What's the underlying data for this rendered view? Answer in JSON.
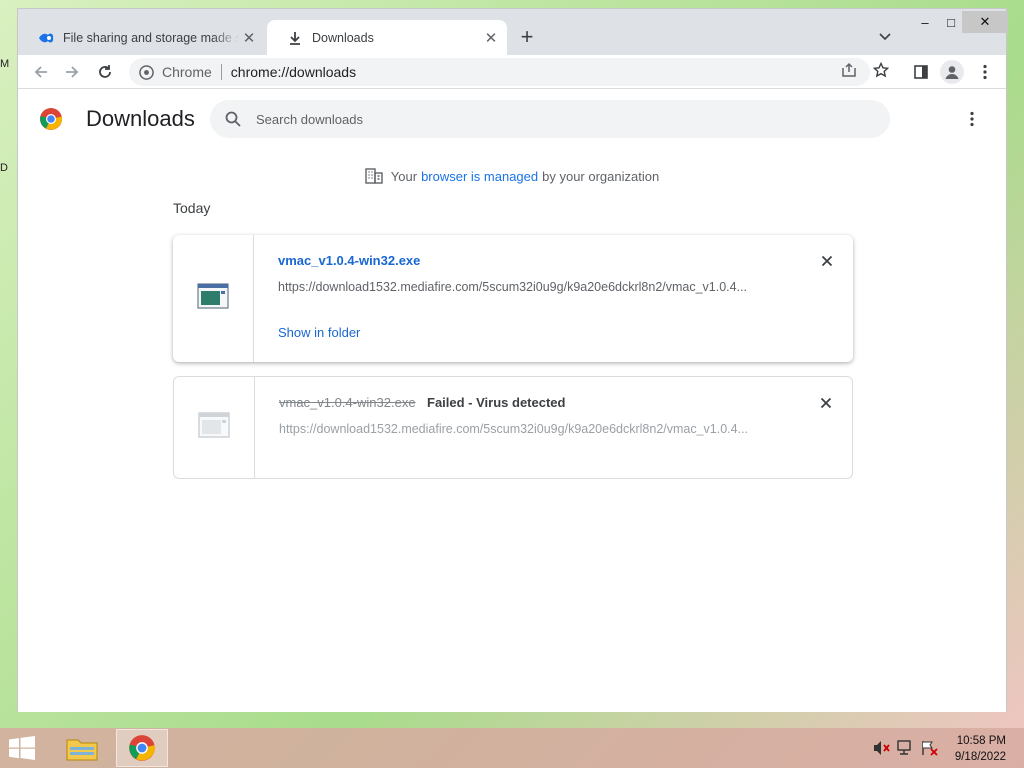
{
  "desktop": {
    "glyph_top": "M",
    "glyph_mid": "D"
  },
  "tabs": [
    {
      "title": "File sharing and storage made simple",
      "icon": "mediafire-icon"
    },
    {
      "title": "Downloads",
      "icon": "download-icon"
    }
  ],
  "window_controls": {
    "minimize": "–",
    "maximize": "□",
    "close": "✕"
  },
  "omnibox": {
    "chip": "Chrome",
    "url": "chrome://downloads"
  },
  "page": {
    "title": "Downloads",
    "search_placeholder": "Search downloads",
    "managed": {
      "prefix": "Your",
      "link": "browser is managed",
      "suffix": "by your organization"
    },
    "date_header": "Today",
    "items": [
      {
        "filename": "vmac_v1.0.4-win32.exe",
        "url": "https://download1532.mediafire.com/5scum32i0u9g/k9a20e6dckrl8n2/vmac_v1.0.4...",
        "action": "Show in folder"
      },
      {
        "filename": "vmac_v1.0.4-win32.exe",
        "status": "Failed - Virus detected",
        "url": "https://download1532.mediafire.com/5scum32i0u9g/k9a20e6dckrl8n2/vmac_v1.0.4..."
      }
    ]
  },
  "taskbar": {
    "time": "10:58 PM",
    "date": "9/18/2022"
  },
  "colors": {
    "link": "#1a73e8",
    "title_bar": "#dee1e6",
    "taskbar": "#d6aaa0"
  }
}
